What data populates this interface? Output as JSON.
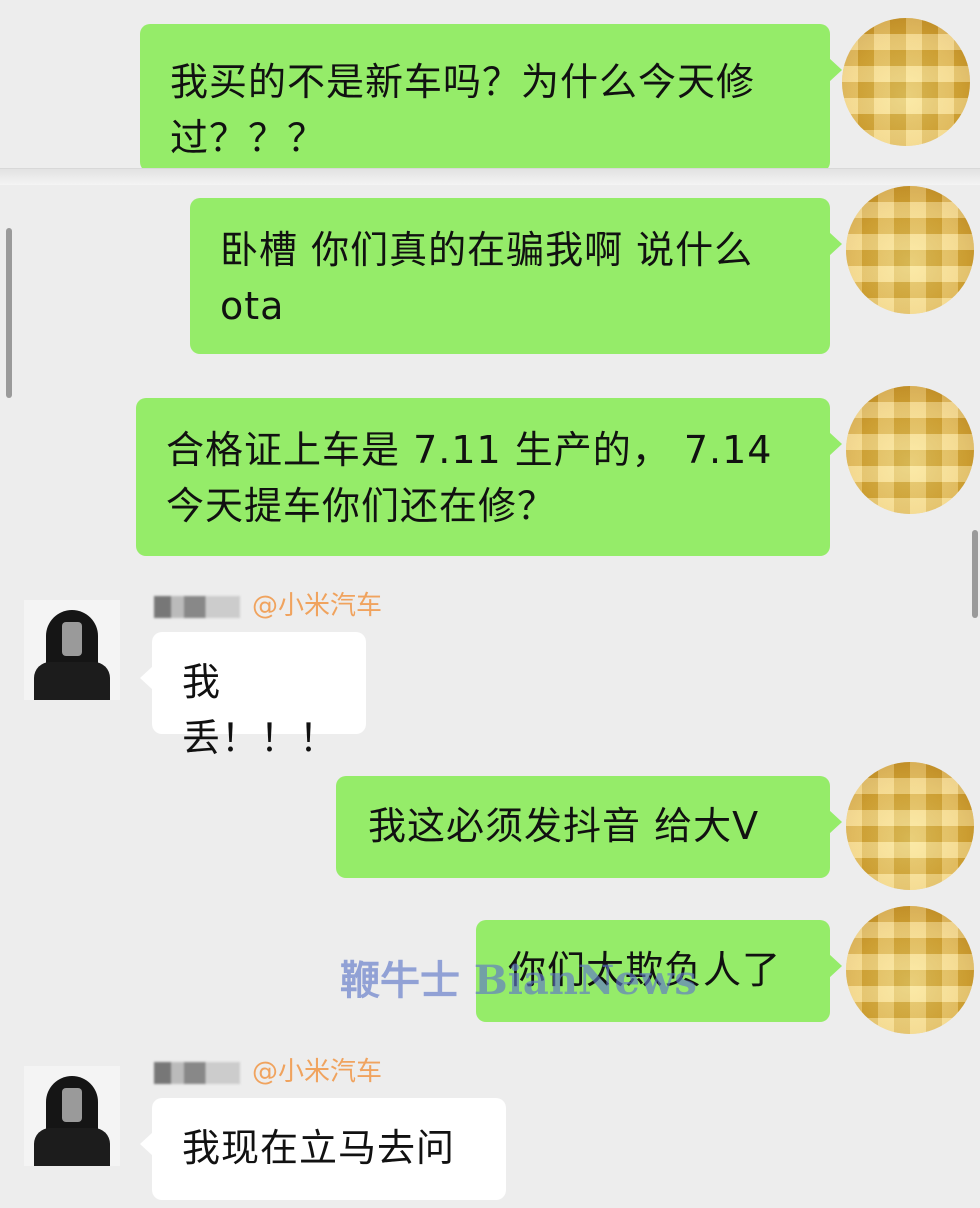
{
  "messages": [
    {
      "side": "out",
      "text": "我买的不是新车吗？为什么今天修过？？？"
    },
    {
      "side": "out",
      "text": "卧槽 你们真的在骗我啊 说什么ota"
    },
    {
      "side": "out",
      "text": "合格证上车是 7.11 生产的， 7.14 今天提车你们还在修？"
    },
    {
      "side": "in",
      "sender_tag": "@小米汽车",
      "text": "我丢！！！"
    },
    {
      "side": "out",
      "text": "我这必须发抖音 给大V"
    },
    {
      "side": "out",
      "text": "你们太欺负人了"
    },
    {
      "side": "in",
      "sender_tag": "@小米汽车",
      "text": "我现在立马去问"
    }
  ],
  "watermark": "鞭牛士 BianNews",
  "colors": {
    "background": "#ededed",
    "outgoing_bubble": "#95ec69",
    "incoming_bubble": "#ffffff",
    "sender_tag": "#f0a35e"
  }
}
